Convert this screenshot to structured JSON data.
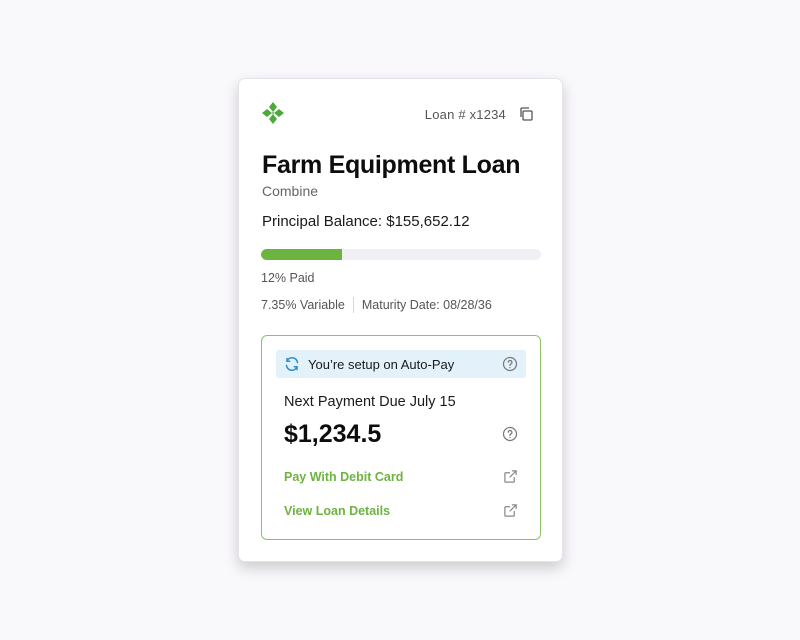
{
  "header": {
    "loan_number": "Loan # x1234",
    "logo_icon": "clover-logo-icon",
    "copy_icon": "copy-icon"
  },
  "loan": {
    "title": "Farm Equipment Loan",
    "subtitle": "Combine",
    "balance": "Principal Balance: $155,652.12",
    "progress_fraction": 0.29,
    "paid_label": "12% Paid",
    "rate": "7.35% Variable",
    "maturity": "Maturity Date: 08/28/36"
  },
  "payment": {
    "autopay_text": "You’re setup on Auto-Pay",
    "next_due": "Next Payment Due July 15",
    "amount": "$1,234.5",
    "pay_debit_label": "Pay With Debit Card",
    "view_details_label": "View Loan Details"
  },
  "colors": {
    "accent_green": "#6db33f",
    "autopay_bg": "#e3f1fb",
    "box_border": "#8bc265"
  }
}
